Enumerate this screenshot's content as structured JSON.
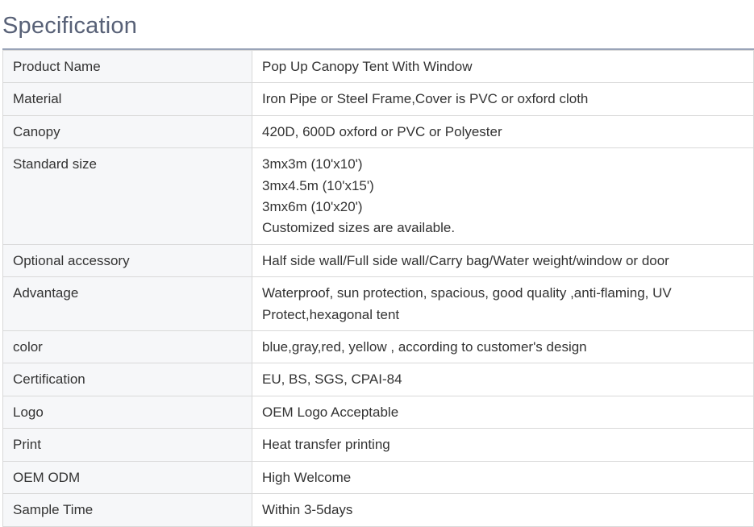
{
  "title": "Specification",
  "rows": [
    {
      "label": "Product Name",
      "value": [
        "Pop Up Canopy Tent With Window"
      ]
    },
    {
      "label": "Material",
      "value": [
        "Iron Pipe or Steel Frame,Cover is PVC or oxford cloth"
      ]
    },
    {
      "label": "Canopy",
      "value": [
        "420D, 600D oxford or PVC or Polyester"
      ]
    },
    {
      "label": "Standard size",
      "value": [
        "3mx3m (10'x10')",
        "3mx4.5m (10'x15')",
        "3mx6m (10'x20')",
        "Customized sizes are available."
      ]
    },
    {
      "label": "Optional accessory",
      "value": [
        "Half side wall/Full side wall/Carry bag/Water weight/window or door"
      ]
    },
    {
      "label": "Advantage",
      "value": [
        "Waterproof, sun protection, spacious, good quality ,anti-flaming, UV",
        "Protect,hexagonal tent"
      ]
    },
    {
      "label": "color",
      "value": [
        "blue,gray,red, yellow , according to customer's design"
      ]
    },
    {
      "label": "Certification",
      "value": [
        "EU, BS, SGS, CPAI-84"
      ]
    },
    {
      "label": "Logo",
      "value": [
        "OEM Logo Acceptable"
      ]
    },
    {
      "label": "Print",
      "value": [
        "Heat transfer printing"
      ]
    },
    {
      "label": "OEM ODM",
      "value": [
        "High Welcome"
      ]
    },
    {
      "label": "Sample Time",
      "value": [
        "Within 3-5days"
      ]
    }
  ]
}
